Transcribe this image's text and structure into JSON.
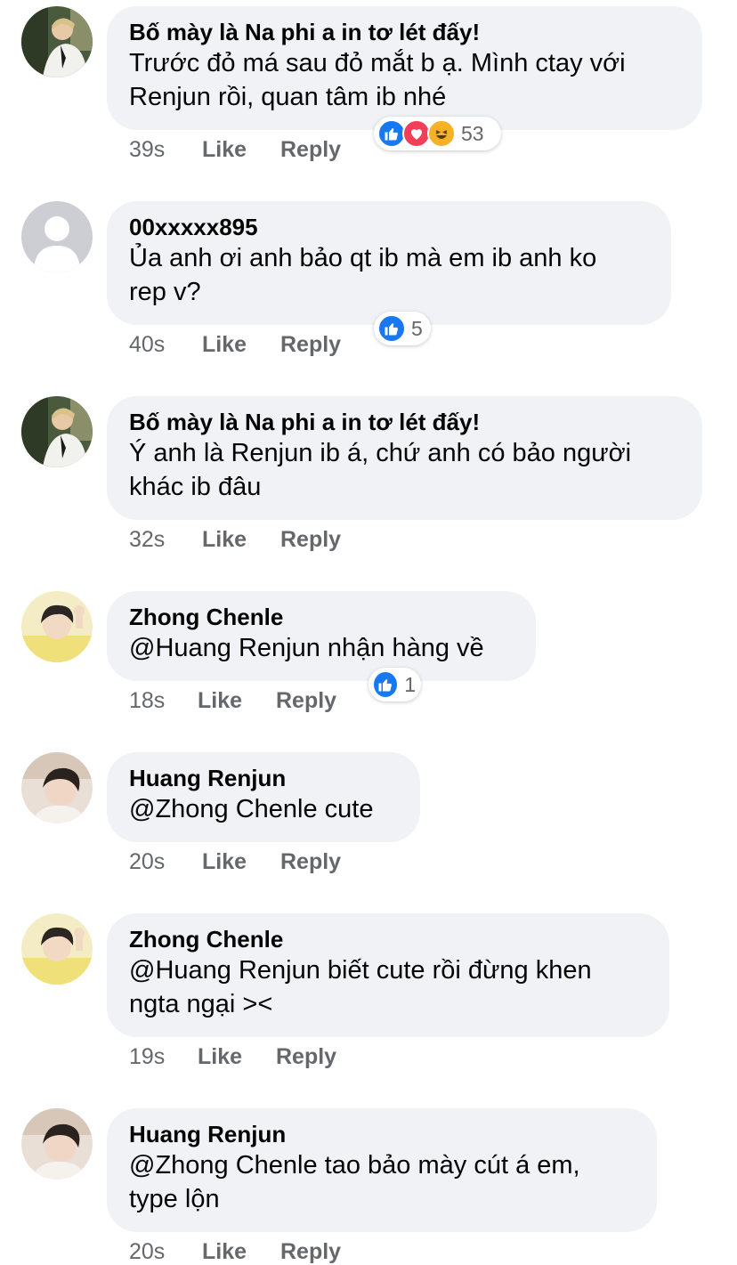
{
  "colors": {
    "bubble_bg": "#f0f2f5",
    "meta_text": "#65676b",
    "like_blue": "#1877f2",
    "love_red": "#f33e58",
    "haha_yellow": "#f7b125"
  },
  "comments": [
    {
      "author": "Bố mày là Na phi a in tơ lét đấy!",
      "text": "Trước đỏ má sau đỏ mắt b ạ. Mình ctay với\nRenjun rồi, quan tâm ib nhé",
      "time": "39s",
      "like_label": "Like",
      "reply_label": "Reply",
      "reactions": [
        "like-icon",
        "love-icon",
        "haha-icon"
      ],
      "reaction_count": "53"
    },
    {
      "author": "00xxxxx895",
      "text": "Ủa anh ơi anh bảo qt ib mà em ib anh ko\nrep v?",
      "time": "40s",
      "like_label": "Like",
      "reply_label": "Reply",
      "reactions": [
        "like-icon"
      ],
      "reaction_count": "5"
    },
    {
      "author": "Bố mày là Na phi a in tơ lét đấy!",
      "text": "Ý anh là Renjun ib á, chứ anh có bảo người\nkhác ib đâu",
      "time": "32s",
      "like_label": "Like",
      "reply_label": "Reply"
    },
    {
      "author": "Zhong Chenle",
      "text": "@Huang Renjun nhận hàng về",
      "time": "18s",
      "like_label": "Like",
      "reply_label": "Reply",
      "reactions": [
        "like-icon"
      ],
      "reaction_count": "1"
    },
    {
      "author": "Huang Renjun",
      "text": "@Zhong Chenle cute",
      "time": "20s",
      "like_label": "Like",
      "reply_label": "Reply"
    },
    {
      "author": "Zhong Chenle",
      "text": "@Huang Renjun biết cute rồi đừng khen\nngta ngại ><",
      "time": "19s",
      "like_label": "Like",
      "reply_label": "Reply"
    },
    {
      "author": "Huang Renjun",
      "text": "@Zhong Chenle tao bảo mày cút á em,\ntype lộn",
      "time": "20s",
      "like_label": "Like",
      "reply_label": "Reply"
    }
  ]
}
